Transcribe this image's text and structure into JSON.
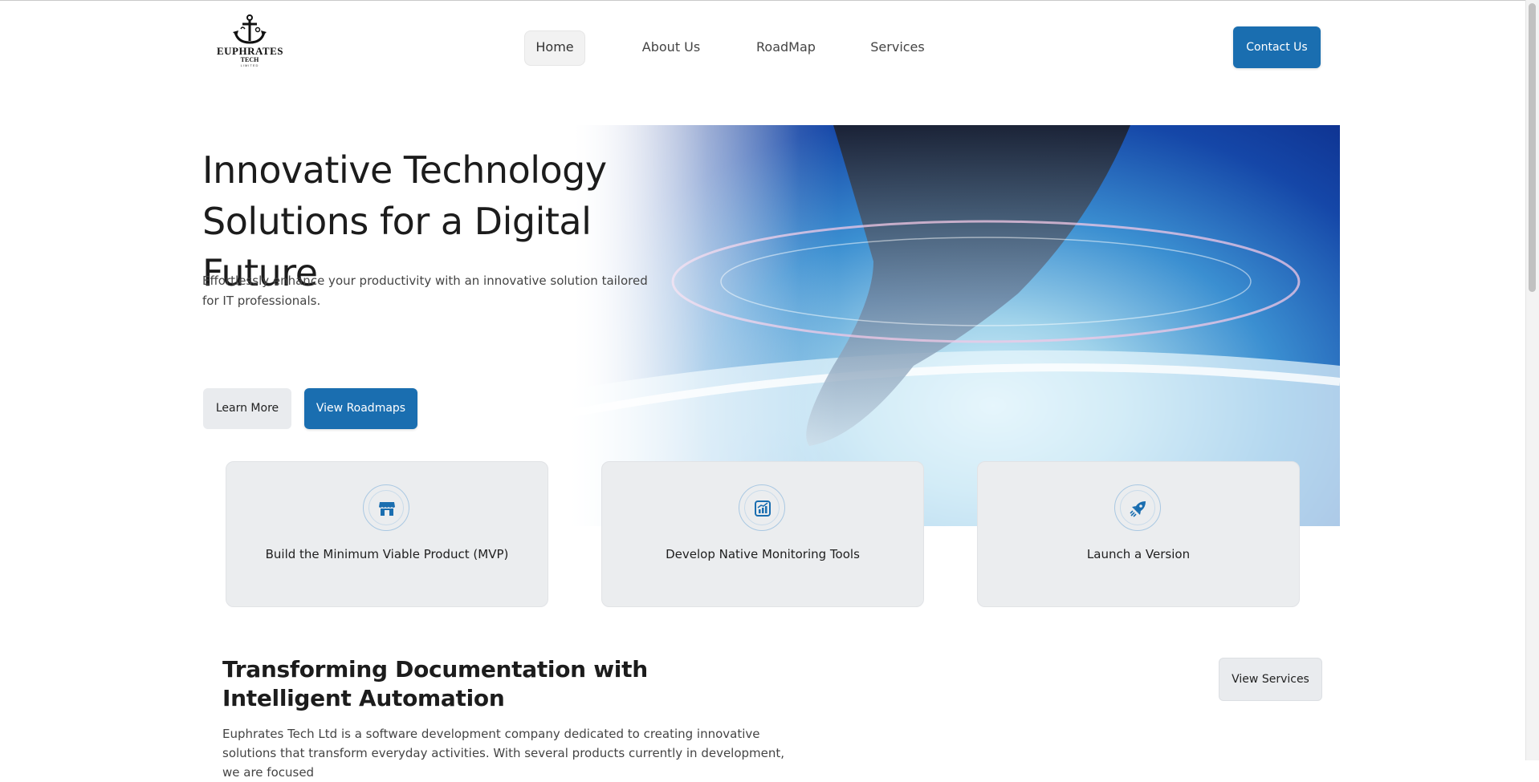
{
  "brand": {
    "name": "EUPHRATES",
    "sub": "TECH",
    "tagline": "LIMITED"
  },
  "nav": {
    "items": [
      {
        "label": "Home",
        "active": true
      },
      {
        "label": "About Us",
        "active": false
      },
      {
        "label": "RoadMap",
        "active": false
      },
      {
        "label": "Services",
        "active": false
      }
    ],
    "contact_label": "Contact Us"
  },
  "hero": {
    "title": "Innovative Technology Solutions for a Digital Future",
    "description": "Effortlessly enhance your productivity with an innovative solution tailored for IT professionals.",
    "learn_more_label": "Learn More",
    "view_roadmaps_label": "View Roadmaps"
  },
  "features": [
    {
      "icon": "storefront-icon",
      "title": "Build the Minimum Viable Product (MVP)"
    },
    {
      "icon": "chart-monitor-icon",
      "title": "Develop Native Monitoring Tools"
    },
    {
      "icon": "rocket-icon",
      "title": "Launch a Version"
    }
  ],
  "section": {
    "title": "Transforming Documentation with Intelligent Automation",
    "description": "Euphrates Tech Ltd is a software development company dedicated to creating innovative solutions that transform everyday activities. With several products currently in development, we are focused",
    "view_services_label": "View Services"
  },
  "colors": {
    "accent": "#1a6eb0",
    "button_secondary": "#e9ebee",
    "card_bg": "#ebedef"
  }
}
